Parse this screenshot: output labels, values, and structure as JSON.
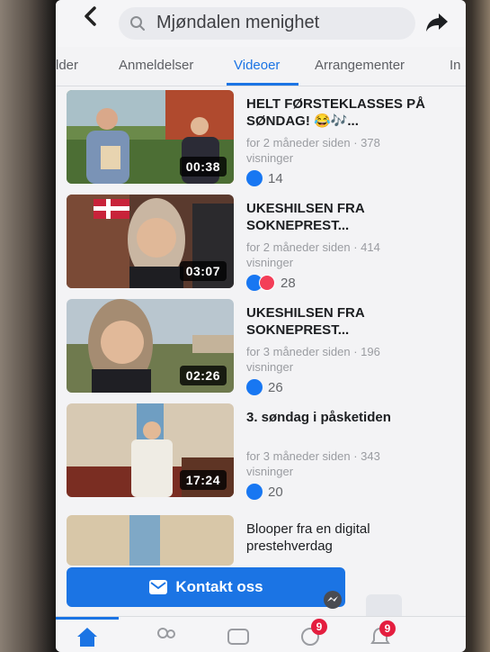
{
  "header": {
    "search_text": "Mjøndalen menighet"
  },
  "tabs": [
    {
      "label": "lder",
      "active": false
    },
    {
      "label": "Anmeldelser",
      "active": false
    },
    {
      "label": "Videoer",
      "active": true
    },
    {
      "label": "Arrangementer",
      "active": false
    },
    {
      "label": "In",
      "active": false
    }
  ],
  "videos": [
    {
      "title": "HELT FØRSTEKLASSES PÅ SØNDAG! 😂🎶...",
      "meta": "for 2 måneder siden · 378 visninger",
      "duration": "00:38",
      "reactions": "14",
      "has_love": false
    },
    {
      "title": "UKESHILSEN FRA SOKNEPREST...",
      "meta": "for 2 måneder siden · 414 visninger",
      "duration": "03:07",
      "reactions": "28",
      "has_love": true
    },
    {
      "title": "UKESHILSEN FRA SOKNEPREST...",
      "meta": "for 3 måneder siden · 196 visninger",
      "duration": "02:26",
      "reactions": "26",
      "has_love": false
    },
    {
      "title": "3. søndag i påsketiden",
      "meta": "for 3 måneder siden · 343 visninger",
      "duration": "17:24",
      "reactions": "20",
      "has_love": false
    },
    {
      "title": "Blooper fra en digital prestehverdag",
      "meta": "",
      "duration": "",
      "reactions": "",
      "has_love": false
    }
  ],
  "actions": {
    "contact_label": "Kontakt oss"
  },
  "bottom_nav": {
    "badge_1": "9",
    "badge_2": "9"
  },
  "colors": {
    "accent": "#1b74e4",
    "like": "#1877f2",
    "love": "#f33e58",
    "badge": "#e41e3f"
  }
}
